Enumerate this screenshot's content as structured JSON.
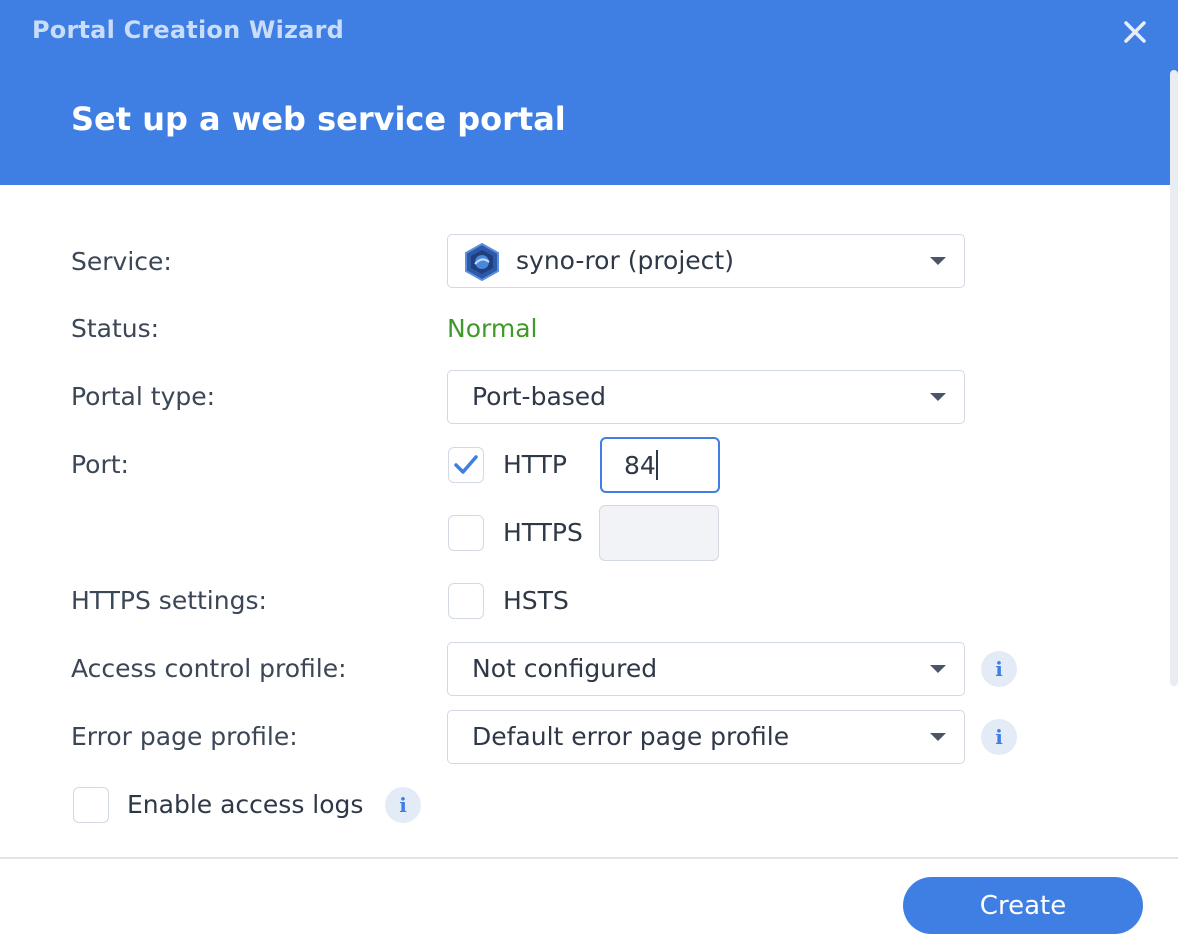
{
  "window": {
    "title": "Portal Creation Wizard",
    "heading": "Set up a web service portal"
  },
  "form": {
    "service": {
      "label": "Service:",
      "value": "syno-ror (project)",
      "icon": "project-hexagon-icon"
    },
    "status": {
      "label": "Status:",
      "value": "Normal",
      "color": "#3f9a2a"
    },
    "portal_type": {
      "label": "Portal type:",
      "value": "Port-based"
    },
    "port": {
      "label": "Port:",
      "http": {
        "label": "HTTP",
        "checked": true,
        "value": "84"
      },
      "https": {
        "label": "HTTPS",
        "checked": false,
        "value": ""
      }
    },
    "https_settings": {
      "label": "HTTPS settings:",
      "hsts": {
        "label": "HSTS",
        "checked": false
      }
    },
    "access_control": {
      "label": "Access control profile:",
      "value": "Not configured"
    },
    "error_page": {
      "label": "Error page profile:",
      "value": "Default error page profile"
    },
    "access_logs": {
      "label": "Enable access logs",
      "checked": false
    }
  },
  "footer": {
    "create_label": "Create"
  },
  "colors": {
    "accent": "#3f7fe3",
    "status_ok": "#3f9a2a"
  }
}
